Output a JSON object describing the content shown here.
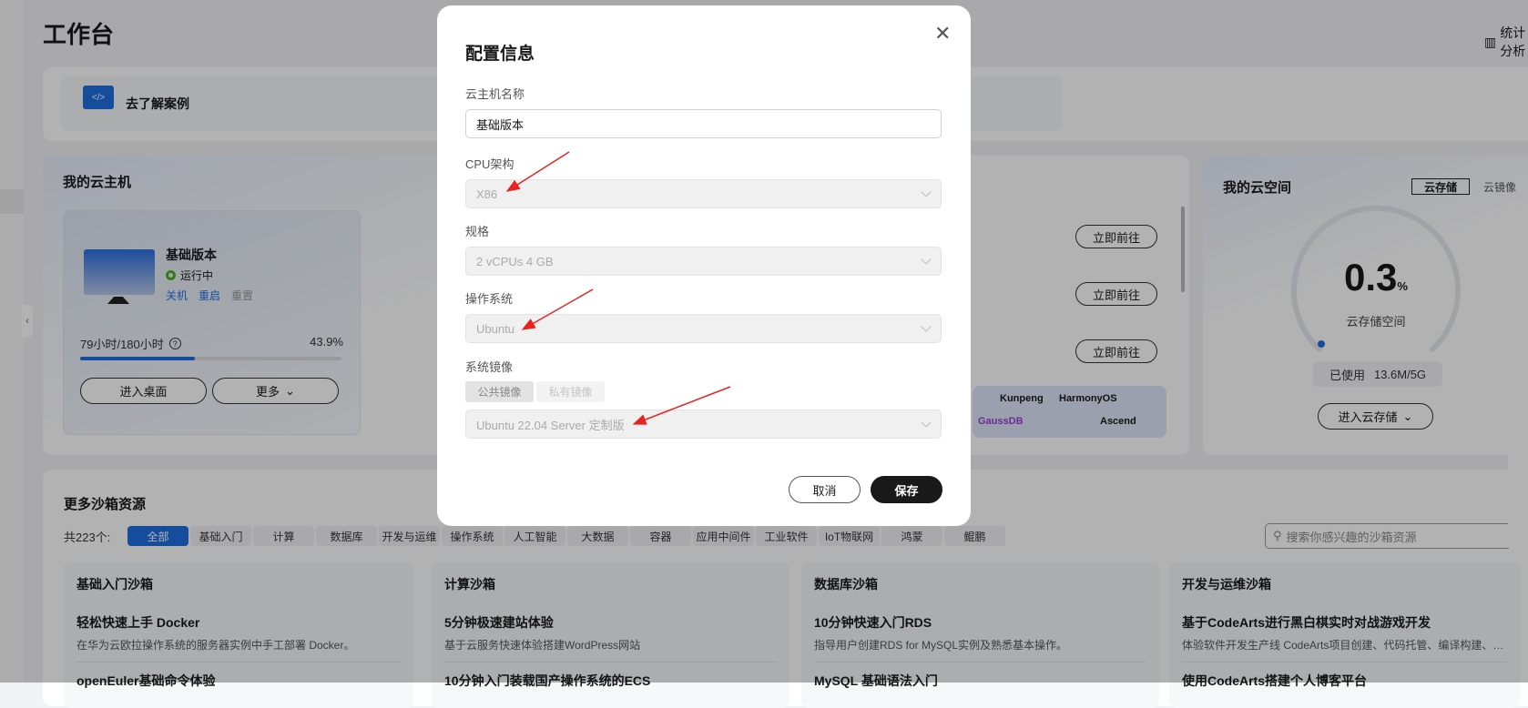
{
  "page": {
    "title": "工作台",
    "stats_label": "统计分析"
  },
  "banner": {
    "label": "去了解案例"
  },
  "vm": {
    "title": "我的云主机",
    "name": "基础版本",
    "status": "运行中",
    "actions": [
      "关机",
      "重启",
      "重置"
    ],
    "usage_text": "79小时/180小时",
    "usage_percent_text": "43.9%",
    "usage_fraction": 0.439,
    "enter_label": "进入桌面",
    "more_label": "更多",
    "goto_labels": [
      "立即前往",
      "立即前往",
      "立即前往"
    ],
    "logos": [
      "Kunpeng",
      "HarmonyOS",
      "GaussDB",
      "Ascend"
    ]
  },
  "space": {
    "title": "我的云空间",
    "tabs": [
      "云存储",
      "云镜像"
    ],
    "value": "0.3",
    "unit": "%",
    "caption": "云存储空间",
    "used_label": "已使用",
    "used_value": "13.6M/5G",
    "enter_label": "进入云存储",
    "fraction": 0.003
  },
  "sandbox": {
    "title": "更多沙箱资源",
    "count": "共223个:",
    "tabs": [
      "全部",
      "基础入门",
      "计算",
      "数据库",
      "开发与运维",
      "操作系统",
      "人工智能",
      "大数据",
      "容器",
      "应用中间件",
      "工业软件",
      "IoT物联网",
      "鸿蒙",
      "鲲鹏"
    ],
    "search_placeholder": "搜索你感兴趣的沙箱资源",
    "columns": [
      {
        "title": "基础入门沙箱",
        "items": [
          {
            "name": "轻松快速上手 Docker",
            "desc": "在华为云欧拉操作系统的服务器实例中手工部署 Docker。"
          },
          {
            "name": "openEuler基础命令体验",
            "desc": ""
          }
        ]
      },
      {
        "title": "计算沙箱",
        "items": [
          {
            "name": "5分钟极速建站体验",
            "desc": "基于云服务快速体验搭建WordPress网站"
          },
          {
            "name": "10分钟入门装载国产操作系统的ECS",
            "desc": ""
          }
        ]
      },
      {
        "title": "数据库沙箱",
        "items": [
          {
            "name": "10分钟快速入门RDS",
            "desc": "指导用户创建RDS for MySQL实例及熟悉基本操作。"
          },
          {
            "name": "MySQL 基础语法入门",
            "desc": ""
          }
        ]
      },
      {
        "title": "开发与运维沙箱",
        "items": [
          {
            "name": "基于CodeArts进行黑白棋实时对战游戏开发",
            "desc": "体验软件开发生产线 CodeArts项目创建、代码托管、编译构建、发布..."
          },
          {
            "name": "使用CodeArts搭建个人博客平台",
            "desc": ""
          }
        ]
      }
    ]
  },
  "dialog": {
    "title": "配置信息",
    "name_label": "云主机名称",
    "name_value": "基础版本",
    "cpu_label": "CPU架构",
    "cpu_value": "X86",
    "spec_label": "规格",
    "spec_value": "2 vCPUs 4 GB",
    "os_label": "操作系统",
    "os_value": "Ubuntu",
    "image_label": "系统镜像",
    "image_tabs": [
      "公共镜像",
      "私有镜像"
    ],
    "image_value": "Ubuntu 22.04 Server 定制版",
    "cancel_label": "取消",
    "save_label": "保存"
  }
}
